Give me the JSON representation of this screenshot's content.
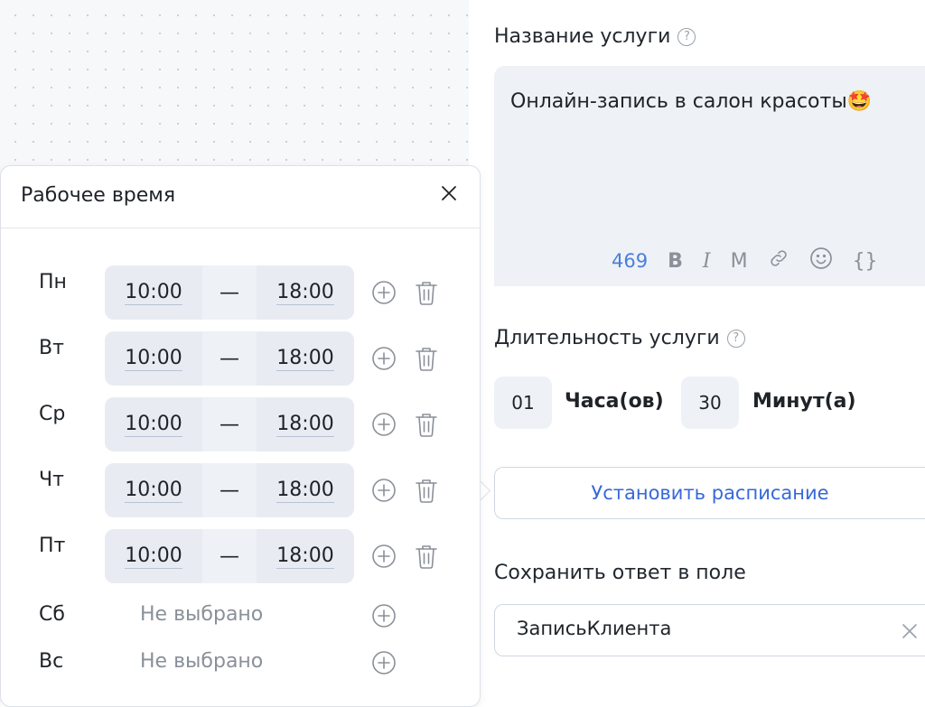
{
  "service": {
    "name_label": "Название услуги",
    "help_glyph": "?",
    "name_value": "Онлайн-запись в салон красоты🤩",
    "char_counter": "469",
    "toolbar": {
      "bold": "B",
      "italic": "I",
      "mono": "M",
      "link_icon": "link-icon",
      "emoji_icon": "emoji-icon",
      "vars": "{}"
    }
  },
  "duration": {
    "label": "Длительность услуги",
    "hours_value": "01",
    "hours_unit": "Часа(ов)",
    "minutes_value": "30",
    "minutes_unit": "Минут(а)"
  },
  "schedule_button": "Установить расписание",
  "save_field": {
    "label": "Сохранить ответ в поле",
    "value": "ЗаписьКлиента"
  },
  "working_hours": {
    "title": "Рабочее время",
    "dash": "—",
    "not_selected": "Не выбрано",
    "days": [
      {
        "label": "Пн",
        "from": "10:00",
        "to": "18:00"
      },
      {
        "label": "Вт",
        "from": "10:00",
        "to": "18:00"
      },
      {
        "label": "Ср",
        "from": "10:00",
        "to": "18:00"
      },
      {
        "label": "Чт",
        "from": "10:00",
        "to": "18:00"
      },
      {
        "label": "Пт",
        "from": "10:00",
        "to": "18:00"
      },
      {
        "label": "Сб",
        "from": null,
        "to": null
      },
      {
        "label": "Вс",
        "from": null,
        "to": null
      }
    ]
  },
  "colors": {
    "accent": "#3768d8",
    "counter": "#4a7fd9",
    "field_bg": "#eef1f6",
    "muted": "#8a9099"
  }
}
